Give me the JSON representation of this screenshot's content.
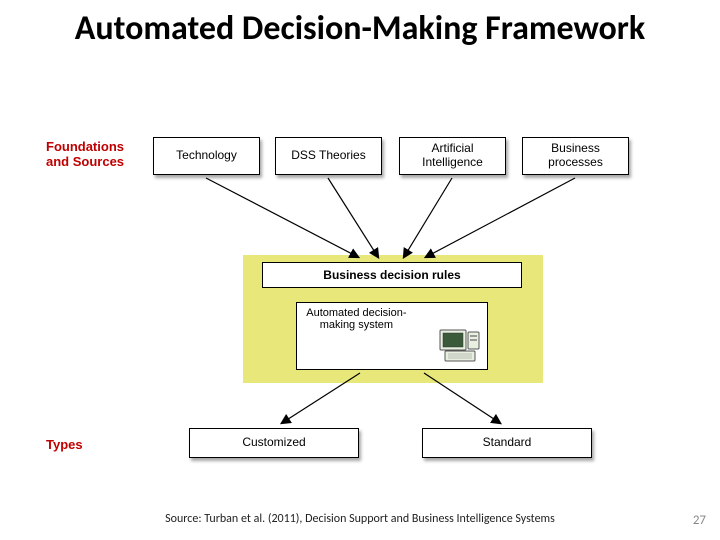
{
  "title": "Automated Decision-Making Framework",
  "labels": {
    "foundations": "Foundations and Sources",
    "types": "Types"
  },
  "top_boxes": {
    "technology": "Technology",
    "dss": "DSS Theories",
    "ai": "Artificial Intelligence",
    "bp": "Business processes"
  },
  "middle": {
    "rules": "Business decision rules",
    "system": "Automated decision-making system"
  },
  "bottom_boxes": {
    "customized": "Customized",
    "standard": "Standard"
  },
  "source": "Source: Turban et al. (2011), Decision Support and Business Intelligence Systems",
  "page_number": "27"
}
